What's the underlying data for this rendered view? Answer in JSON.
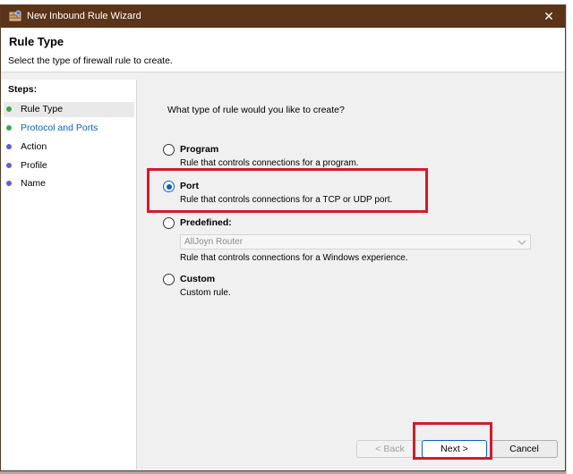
{
  "window": {
    "title": "New Inbound Rule Wizard",
    "close_glyph": "✕",
    "title_bar_color": "#5c3419"
  },
  "header": {
    "title": "Rule Type",
    "subtitle": "Select the type of firewall rule to create."
  },
  "steps": {
    "heading": "Steps:",
    "items": [
      {
        "label": "Rule Type",
        "state": "current",
        "dot_color": "#3aa84a"
      },
      {
        "label": "Protocol and Ports",
        "state": "next",
        "dot_color": "#3aa84a"
      },
      {
        "label": "Action",
        "state": "pending",
        "dot_color": "#5f5fd0"
      },
      {
        "label": "Profile",
        "state": "pending",
        "dot_color": "#5f5fd0"
      },
      {
        "label": "Name",
        "state": "pending",
        "dot_color": "#5f5fd0"
      }
    ]
  },
  "main": {
    "question": "What type of rule would you like to create?",
    "options": [
      {
        "label": "Program",
        "description": "Rule that controls connections for a program.",
        "selected": false
      },
      {
        "label": "Port",
        "description": "Rule that controls connections for a TCP or UDP port.",
        "selected": true
      },
      {
        "label": "Predefined:",
        "description": "Rule that controls connections for a Windows experience.",
        "selected": false
      },
      {
        "label": "Custom",
        "description": "Custom rule.",
        "selected": false
      }
    ],
    "predefined_select": {
      "value": "AllJoyn Router",
      "disabled": true
    }
  },
  "buttons": {
    "back": "< Back",
    "next": "Next >",
    "cancel": "Cancel"
  },
  "annotations": {
    "highlight_color": "#d01c2b"
  },
  "icons": {
    "app": "firewall-icon",
    "close": "close-icon",
    "dropdown": "chevron-down-icon"
  }
}
